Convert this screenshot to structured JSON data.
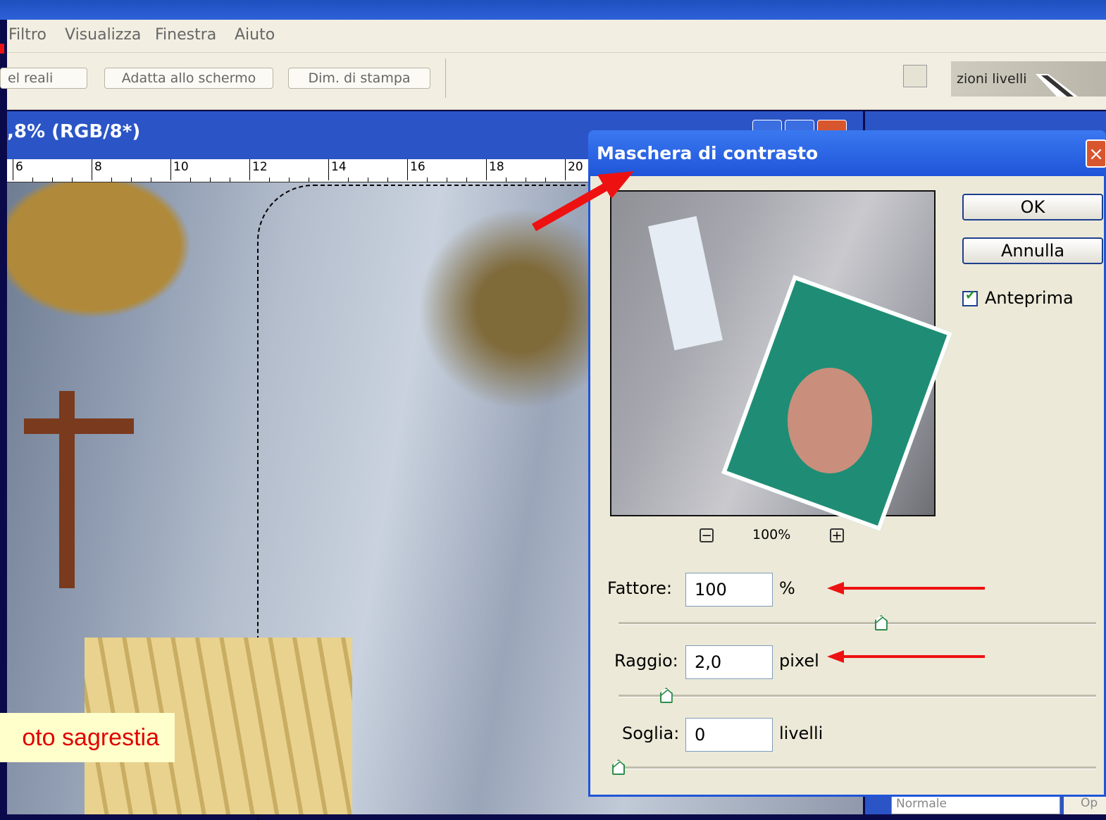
{
  "menu": [
    "Filtro",
    "Visualizza",
    "Finestra",
    "Aiuto"
  ],
  "options_bar": {
    "buttons": [
      "el reali",
      "Adatta allo schermo",
      "Dim. di stampa"
    ],
    "palette_tab": "zioni livelli"
  },
  "document": {
    "title": ",8% (RGB/8*)",
    "ruler_labels": [
      "6",
      "8",
      "10",
      "12",
      "14",
      "16",
      "18",
      "20"
    ]
  },
  "caption": "oto sagrestia",
  "layers_panel": {
    "blend_mode": "Normale",
    "opacity_label": "Op"
  },
  "dialog": {
    "title": "Maschera di contrasto",
    "close_symbol": "×",
    "ok": "OK",
    "cancel": "Annulla",
    "preview_label": "Anteprima",
    "preview_checked": true,
    "zoom_out_symbol": "−",
    "zoom_in_symbol": "+",
    "zoom": "100%",
    "amount": {
      "label": "Fattore:",
      "value": "100",
      "unit": "%",
      "slider_fraction": 0.55
    },
    "radius": {
      "label": "Raggio:",
      "value": "2,0",
      "unit": "pixel",
      "slider_fraction": 0.1
    },
    "threshold": {
      "label": "Soglia:",
      "value": "0",
      "unit": "livelli",
      "slider_fraction": 0.0
    }
  },
  "colors": {
    "accent_red": "#ee1111",
    "caption_bg": "#ffffcc",
    "dialog_title": "#1f55d9"
  }
}
